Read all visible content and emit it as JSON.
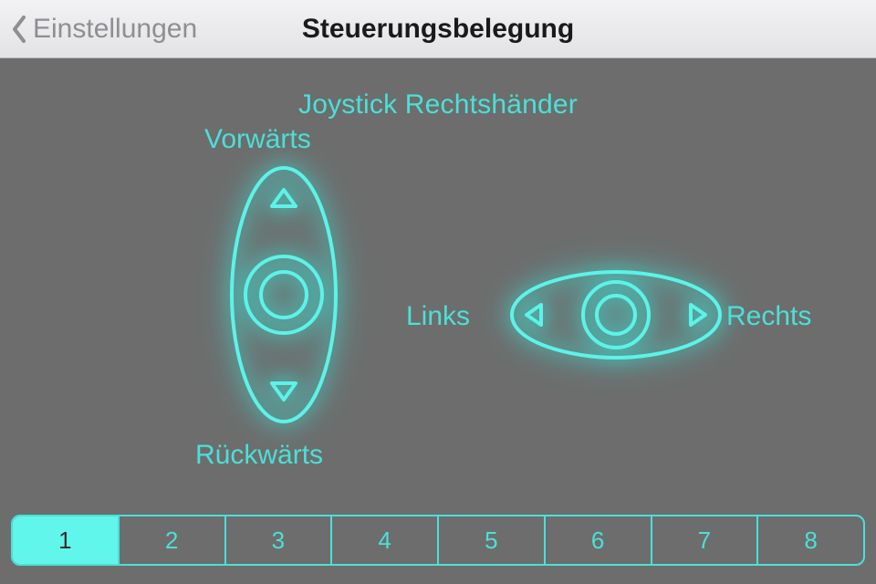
{
  "colors": {
    "accent": "#4be0d7",
    "glow": "#34f5e8",
    "bg": "#6d6d6d"
  },
  "header": {
    "back_label": "Einstellungen",
    "title": "Steuerungsbelegung"
  },
  "scheme": {
    "name": "Joystick Rechtshänder",
    "labels": {
      "forward": "Vorwärts",
      "back": "Rückwärts",
      "left": "Links",
      "right": "Rechts"
    }
  },
  "pager": {
    "options": [
      "1",
      "2",
      "3",
      "4",
      "5",
      "6",
      "7",
      "8"
    ],
    "selected_index": 0
  }
}
